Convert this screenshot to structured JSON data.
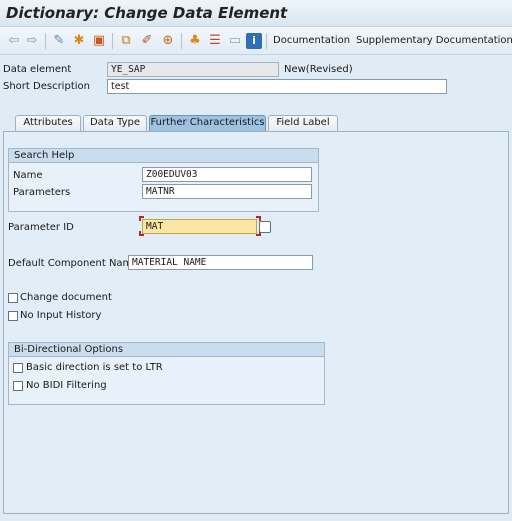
{
  "window": {
    "title": "Dictionary: Change Data Element"
  },
  "toolbar": {
    "icons": [
      "back-arrow-icon",
      "forward-arrow-icon",
      "display-change-icon",
      "activate-icon",
      "other-object-icon",
      "where-used-icon",
      "edit-icon",
      "insert-icon",
      "hierarchy-icon",
      "list-icon",
      "display-object-list-icon",
      "info-icon"
    ],
    "documentation_label": "Documentation",
    "supplementary_label": "Supplementary Documentation"
  },
  "header": {
    "data_element_label": "Data element",
    "data_element_value": "YE_SAP",
    "status": "New(Revised)",
    "short_description_label": "Short Description",
    "short_description_value": "test"
  },
  "tabs": [
    {
      "label": "Attributes",
      "active": false
    },
    {
      "label": "Data Type",
      "active": false
    },
    {
      "label": "Further Characteristics",
      "active": true
    },
    {
      "label": "Field Label",
      "active": false
    }
  ],
  "search_help": {
    "title": "Search Help",
    "name_label": "Name",
    "name_value": "Z00EDUV03",
    "parameters_label": "Parameters",
    "parameters_value": "MATNR"
  },
  "parameter_id": {
    "label": "Parameter ID",
    "value": "MAT"
  },
  "default_component": {
    "label": "Default Component Name",
    "value": "MATERIAL NAME"
  },
  "options": {
    "change_document_label": "Change document",
    "change_document_checked": false,
    "no_input_history_label": "No Input History",
    "no_input_history_checked": false
  },
  "bidi": {
    "title": "Bi-Directional Options",
    "basic_direction_label": "Basic direction is set to LTR",
    "basic_direction_checked": false,
    "no_bidi_label": "No BIDI Filtering",
    "no_bidi_checked": false
  }
}
